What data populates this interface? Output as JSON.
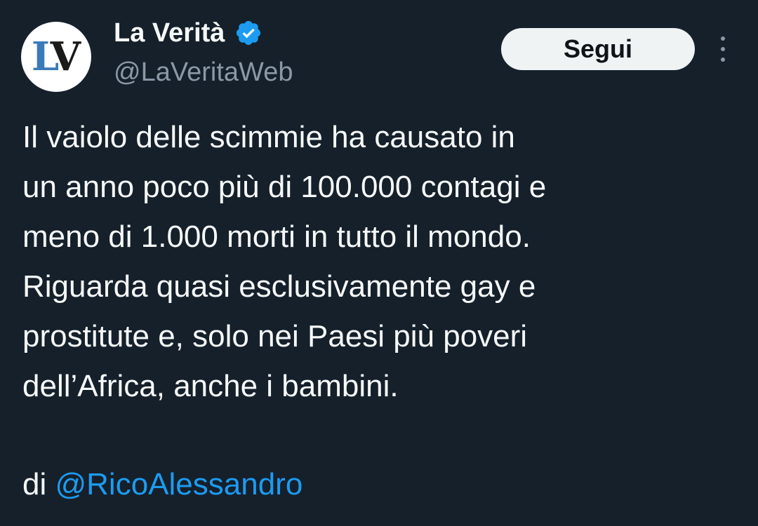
{
  "author": {
    "display_name": "La Verità",
    "handle": "@LaVeritaWeb",
    "verified": true,
    "avatar_text": "LV"
  },
  "actions": {
    "follow_label": "Segui",
    "more_icon": "more-vertical-icon"
  },
  "tweet": {
    "lines": [
      "Il vaiolo delle scimmie ha causato in",
      "un anno poco più di 100.000 contagi e",
      "meno di 1.000 morti in tutto il mondo.",
      "Riguarda quasi esclusivamente gay e",
      "prostitute e, solo nei Paesi più poveri",
      "dell’Africa, anche i bambini."
    ],
    "byline_prefix": "di",
    "mention": "@RicoAlessandro"
  },
  "colors": {
    "background": "#15202b",
    "text": "#f7f9f9",
    "secondary_text": "#8b98a5",
    "link": "#1d9bf0",
    "verified_badge": "#1d9bf0",
    "follow_button_bg": "#eff3f4"
  }
}
